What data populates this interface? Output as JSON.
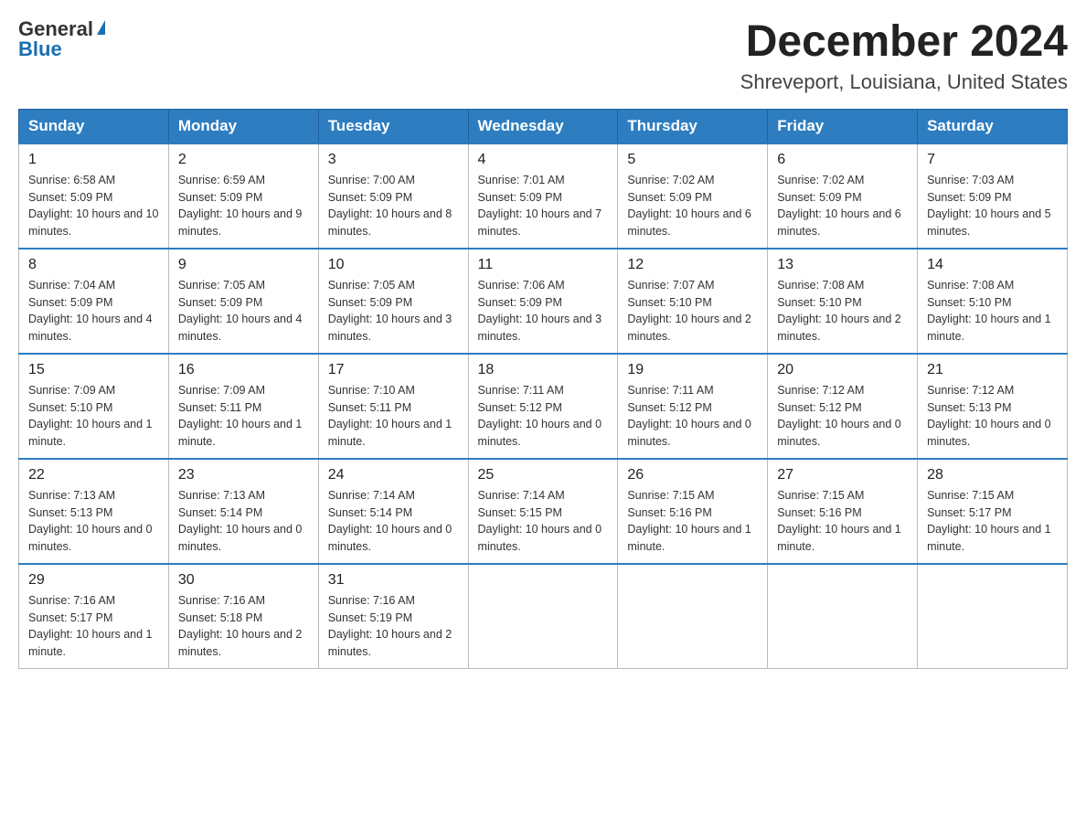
{
  "header": {
    "logo_general": "General",
    "logo_blue": "Blue",
    "month_title": "December 2024",
    "location": "Shreveport, Louisiana, United States"
  },
  "weekdays": [
    "Sunday",
    "Monday",
    "Tuesday",
    "Wednesday",
    "Thursday",
    "Friday",
    "Saturday"
  ],
  "weeks": [
    [
      {
        "day": "1",
        "sunrise": "6:58 AM",
        "sunset": "5:09 PM",
        "daylight": "10 hours and 10 minutes."
      },
      {
        "day": "2",
        "sunrise": "6:59 AM",
        "sunset": "5:09 PM",
        "daylight": "10 hours and 9 minutes."
      },
      {
        "day": "3",
        "sunrise": "7:00 AM",
        "sunset": "5:09 PM",
        "daylight": "10 hours and 8 minutes."
      },
      {
        "day": "4",
        "sunrise": "7:01 AM",
        "sunset": "5:09 PM",
        "daylight": "10 hours and 7 minutes."
      },
      {
        "day": "5",
        "sunrise": "7:02 AM",
        "sunset": "5:09 PM",
        "daylight": "10 hours and 6 minutes."
      },
      {
        "day": "6",
        "sunrise": "7:02 AM",
        "sunset": "5:09 PM",
        "daylight": "10 hours and 6 minutes."
      },
      {
        "day": "7",
        "sunrise": "7:03 AM",
        "sunset": "5:09 PM",
        "daylight": "10 hours and 5 minutes."
      }
    ],
    [
      {
        "day": "8",
        "sunrise": "7:04 AM",
        "sunset": "5:09 PM",
        "daylight": "10 hours and 4 minutes."
      },
      {
        "day": "9",
        "sunrise": "7:05 AM",
        "sunset": "5:09 PM",
        "daylight": "10 hours and 4 minutes."
      },
      {
        "day": "10",
        "sunrise": "7:05 AM",
        "sunset": "5:09 PM",
        "daylight": "10 hours and 3 minutes."
      },
      {
        "day": "11",
        "sunrise": "7:06 AM",
        "sunset": "5:09 PM",
        "daylight": "10 hours and 3 minutes."
      },
      {
        "day": "12",
        "sunrise": "7:07 AM",
        "sunset": "5:10 PM",
        "daylight": "10 hours and 2 minutes."
      },
      {
        "day": "13",
        "sunrise": "7:08 AM",
        "sunset": "5:10 PM",
        "daylight": "10 hours and 2 minutes."
      },
      {
        "day": "14",
        "sunrise": "7:08 AM",
        "sunset": "5:10 PM",
        "daylight": "10 hours and 1 minute."
      }
    ],
    [
      {
        "day": "15",
        "sunrise": "7:09 AM",
        "sunset": "5:10 PM",
        "daylight": "10 hours and 1 minute."
      },
      {
        "day": "16",
        "sunrise": "7:09 AM",
        "sunset": "5:11 PM",
        "daylight": "10 hours and 1 minute."
      },
      {
        "day": "17",
        "sunrise": "7:10 AM",
        "sunset": "5:11 PM",
        "daylight": "10 hours and 1 minute."
      },
      {
        "day": "18",
        "sunrise": "7:11 AM",
        "sunset": "5:12 PM",
        "daylight": "10 hours and 0 minutes."
      },
      {
        "day": "19",
        "sunrise": "7:11 AM",
        "sunset": "5:12 PM",
        "daylight": "10 hours and 0 minutes."
      },
      {
        "day": "20",
        "sunrise": "7:12 AM",
        "sunset": "5:12 PM",
        "daylight": "10 hours and 0 minutes."
      },
      {
        "day": "21",
        "sunrise": "7:12 AM",
        "sunset": "5:13 PM",
        "daylight": "10 hours and 0 minutes."
      }
    ],
    [
      {
        "day": "22",
        "sunrise": "7:13 AM",
        "sunset": "5:13 PM",
        "daylight": "10 hours and 0 minutes."
      },
      {
        "day": "23",
        "sunrise": "7:13 AM",
        "sunset": "5:14 PM",
        "daylight": "10 hours and 0 minutes."
      },
      {
        "day": "24",
        "sunrise": "7:14 AM",
        "sunset": "5:14 PM",
        "daylight": "10 hours and 0 minutes."
      },
      {
        "day": "25",
        "sunrise": "7:14 AM",
        "sunset": "5:15 PM",
        "daylight": "10 hours and 0 minutes."
      },
      {
        "day": "26",
        "sunrise": "7:15 AM",
        "sunset": "5:16 PM",
        "daylight": "10 hours and 1 minute."
      },
      {
        "day": "27",
        "sunrise": "7:15 AM",
        "sunset": "5:16 PM",
        "daylight": "10 hours and 1 minute."
      },
      {
        "day": "28",
        "sunrise": "7:15 AM",
        "sunset": "5:17 PM",
        "daylight": "10 hours and 1 minute."
      }
    ],
    [
      {
        "day": "29",
        "sunrise": "7:16 AM",
        "sunset": "5:17 PM",
        "daylight": "10 hours and 1 minute."
      },
      {
        "day": "30",
        "sunrise": "7:16 AM",
        "sunset": "5:18 PM",
        "daylight": "10 hours and 2 minutes."
      },
      {
        "day": "31",
        "sunrise": "7:16 AM",
        "sunset": "5:19 PM",
        "daylight": "10 hours and 2 minutes."
      },
      null,
      null,
      null,
      null
    ]
  ],
  "labels": {
    "sunrise": "Sunrise:",
    "sunset": "Sunset:",
    "daylight": "Daylight:"
  }
}
